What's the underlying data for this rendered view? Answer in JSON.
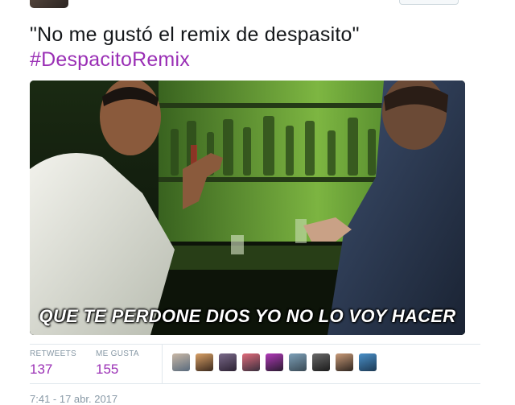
{
  "tweet": {
    "text": "\"No me gustó el remix de despasito\"",
    "hashtag": "#DespacitoRemix"
  },
  "media": {
    "caption": "QUE TE PERDONE DIOS YO NO LO VOY HACER"
  },
  "stats": {
    "retweets_label": "RETWEETS",
    "retweets_count": "137",
    "likes_label": "ME GUSTA",
    "likes_count": "155"
  },
  "likers": [
    {
      "colors": [
        "#c9b8a6",
        "#5a6b7d"
      ]
    },
    {
      "colors": [
        "#d8a066",
        "#3b2a1e"
      ]
    },
    {
      "colors": [
        "#7a6a8a",
        "#2d2233"
      ]
    },
    {
      "colors": [
        "#e06b7b",
        "#3a2f3d"
      ]
    },
    {
      "colors": [
        "#b03ab8",
        "#2a1b30"
      ]
    },
    {
      "colors": [
        "#7da0b8",
        "#3a4a55"
      ]
    },
    {
      "colors": [
        "#6a6a6a",
        "#1c1c1c"
      ]
    },
    {
      "colors": [
        "#c89a78",
        "#2e2620"
      ]
    },
    {
      "colors": [
        "#4a90c8",
        "#1d3a55"
      ]
    }
  ],
  "timestamp": "7:41 - 17 abr. 2017",
  "colors": {
    "hashtag": "#9a2fb5",
    "muted": "#8899a6",
    "divider": "#e1e8ed"
  }
}
